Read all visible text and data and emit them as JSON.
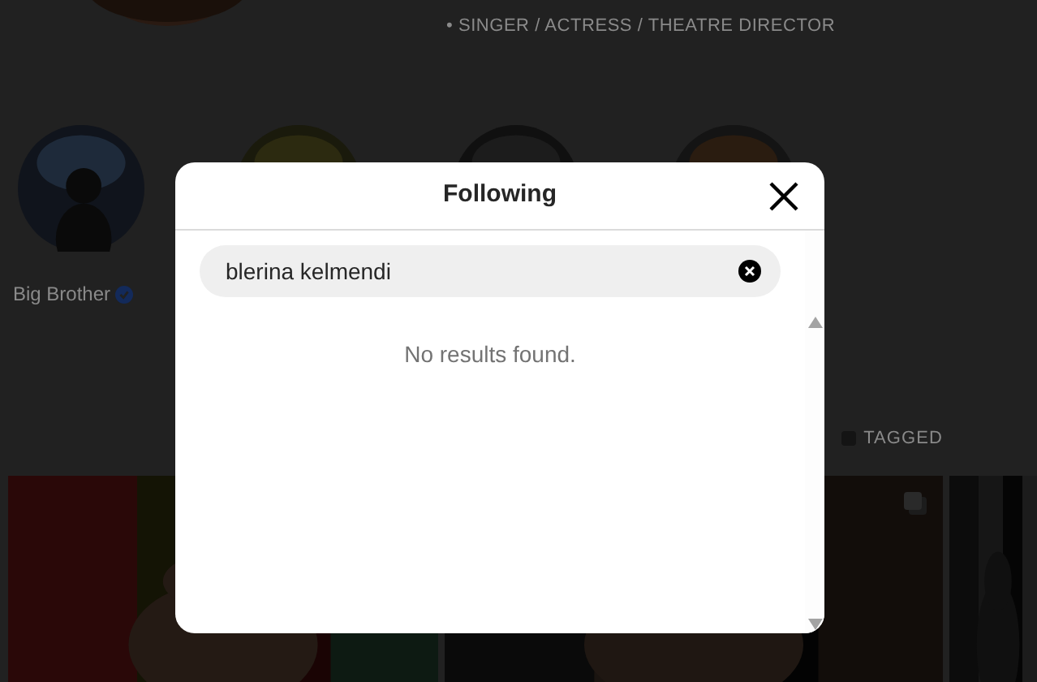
{
  "profile": {
    "bio_line": "• SINGER / ACTRESS / THEATRE DIRECTOR"
  },
  "highlights": [
    {
      "kind": "labeled",
      "label": "Big Brother",
      "verified": true
    },
    {
      "kind": "cover"
    },
    {
      "kind": "cover"
    },
    {
      "kind": "cover"
    }
  ],
  "profile_tabs": [
    {
      "label": "TAGGED"
    }
  ],
  "posts": [
    {
      "kind": "picture"
    },
    {
      "kind": "picture",
      "multiple": true
    },
    {
      "kind": "picture"
    }
  ],
  "dialog": {
    "title": "Following",
    "search": {
      "value": "blerina kelmendi"
    },
    "message": "No results found."
  }
}
